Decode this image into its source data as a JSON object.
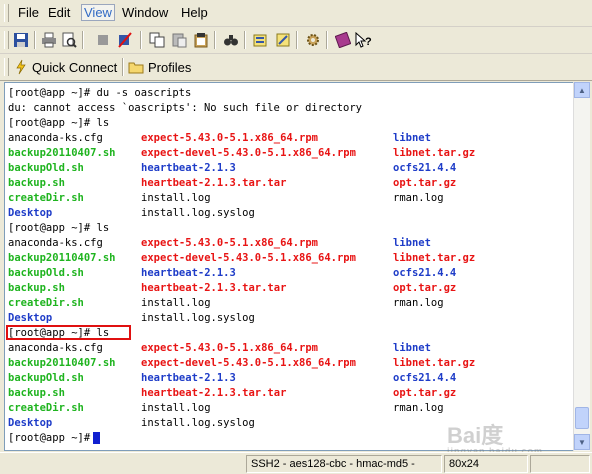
{
  "menubar": {
    "items": [
      {
        "label": "File",
        "active": false
      },
      {
        "label": "Edit",
        "active": false
      },
      {
        "label": "View",
        "active": true
      },
      {
        "label": "Window",
        "active": false
      },
      {
        "label": "Help",
        "active": false
      }
    ]
  },
  "quickbar": {
    "quick_connect_label": "Quick Connect",
    "profiles_label": "Profiles"
  },
  "terminal": {
    "lines": [
      "[root@app ~]# du -s oascripts",
      "du: cannot access `oascripts': No such file or directory",
      "[root@app ~]# ls"
    ],
    "listing": {
      "col1": [
        {
          "text": "anaconda-ks.cfg",
          "color": "plain"
        },
        {
          "text": "backup20110407.sh",
          "color": "green"
        },
        {
          "text": "backupOld.sh",
          "color": "green"
        },
        {
          "text": "backup.sh",
          "color": "green"
        },
        {
          "text": "createDir.sh",
          "color": "green"
        },
        {
          "text": "Desktop",
          "color": "blue"
        }
      ],
      "col2": [
        {
          "text": "expect-5.43.0-5.1.x86_64.rpm",
          "color": "red"
        },
        {
          "text": "expect-devel-5.43.0-5.1.x86_64.rpm",
          "color": "red"
        },
        {
          "text": "heartbeat-2.1.3",
          "color": "blue"
        },
        {
          "text": "heartbeat-2.1.3.tar.tar",
          "color": "red"
        },
        {
          "text": "install.log",
          "color": "plain"
        },
        {
          "text": "install.log.syslog",
          "color": "plain"
        }
      ],
      "col3": [
        {
          "text": "libnet",
          "color": "blue"
        },
        {
          "text": "libnet.tar.gz",
          "color": "red"
        },
        {
          "text": "ocfs21.4.4",
          "color": "blue"
        },
        {
          "text": "opt.tar.gz",
          "color": "red"
        },
        {
          "text": "rman.log",
          "color": "plain"
        },
        {
          "text": ""
        }
      ]
    },
    "ls_prompt": "[root@app ~]# ls",
    "final_prompt": "[root@app ~]#"
  },
  "statusbar": {
    "cipher": "SSH2 - aes128-cbc - hmac-md5 - ",
    "size": "80x24"
  },
  "watermark": {
    "text": "Bai度",
    "sub": "jingyan.baidu.com"
  },
  "colors": {
    "green": "#1fb41f",
    "red": "#e81414",
    "blue": "#1e3cc8",
    "highlight": "#e01010",
    "cursor": "#1020d0"
  }
}
